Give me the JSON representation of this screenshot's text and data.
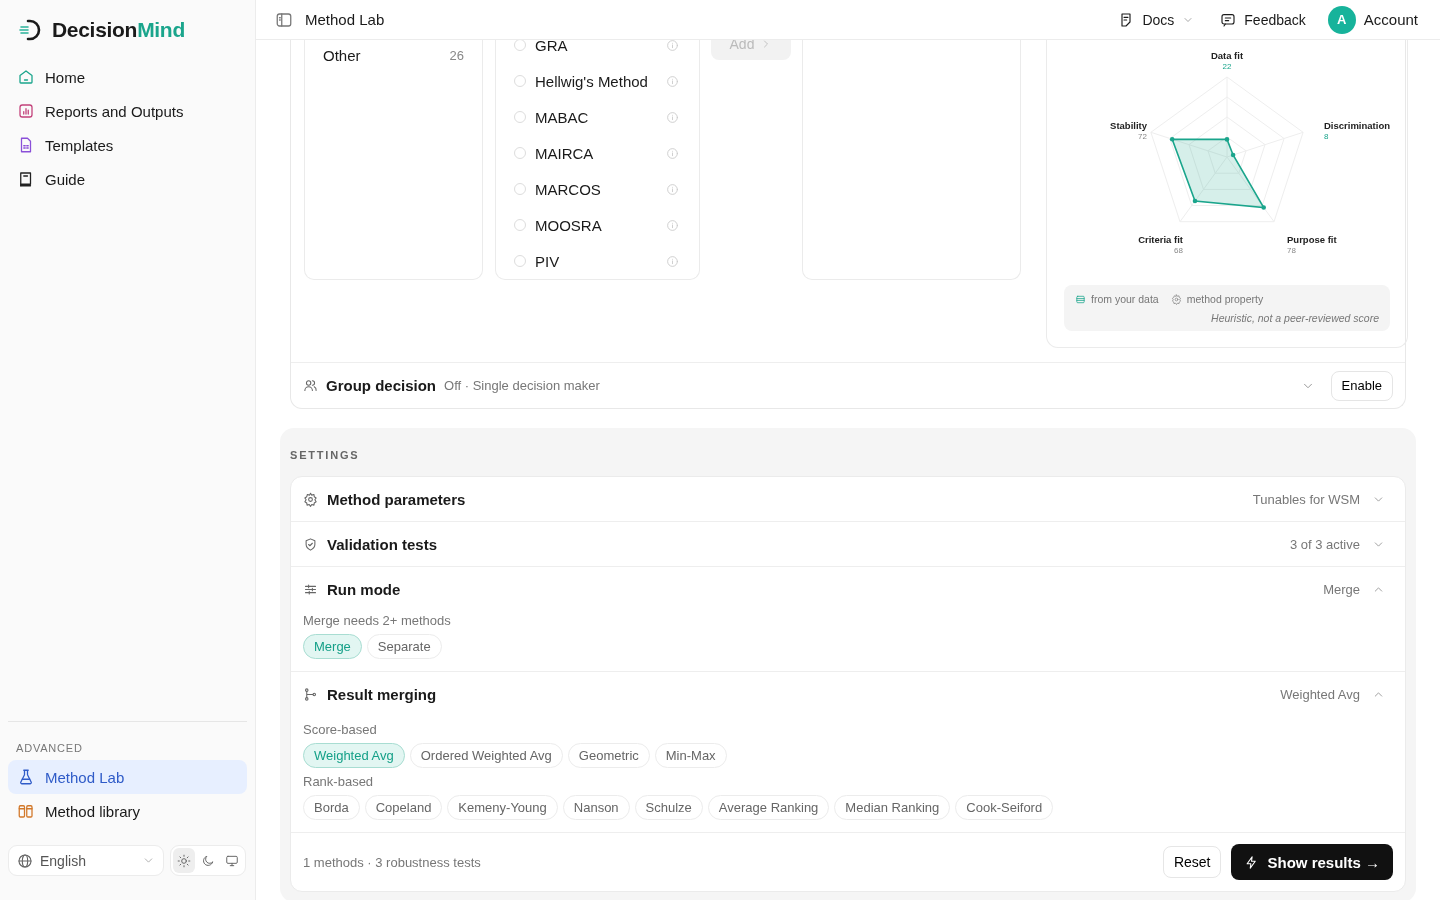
{
  "sidebar": {
    "brand": {
      "name": "Decision",
      "accent": "Mind"
    },
    "nav": [
      {
        "label": "Home",
        "kind": "home",
        "selected": false
      },
      {
        "label": "Reports and Outputs",
        "kind": "reports",
        "selected": false
      },
      {
        "label": "Templates",
        "kind": "templates",
        "selected": false
      },
      {
        "label": "Guide",
        "kind": "guide",
        "selected": false
      }
    ],
    "advanced": {
      "title": "ADVANCED",
      "items": [
        {
          "label": "Method Lab",
          "kind": "lab",
          "selected": true
        },
        {
          "label": "Method library",
          "kind": "library",
          "selected": false
        }
      ]
    },
    "language": "English",
    "themes": [
      {
        "kind": "light",
        "selected": true
      },
      {
        "kind": "dark",
        "selected": false
      },
      {
        "kind": "system",
        "selected": false
      }
    ]
  },
  "header": {
    "title": "Method Lab",
    "docs": "Docs",
    "feedback": "Feedback",
    "avatar": "A",
    "account": "Account"
  },
  "picker": {
    "categories": [
      {
        "label": "Other",
        "count": "26"
      }
    ],
    "methods": [
      {
        "name": "GRA",
        "selected": false
      },
      {
        "name": "Hellwig's Method",
        "selected": false
      },
      {
        "name": "MABAC",
        "selected": false
      },
      {
        "name": "MAIRCA",
        "selected": false
      },
      {
        "name": "MARCOS",
        "selected": false
      },
      {
        "name": "MOOSRA",
        "selected": false
      },
      {
        "name": "PIV",
        "selected": false
      }
    ],
    "add_button": {
      "label": "Add",
      "disabled": true
    },
    "radar": {
      "axes": [
        {
          "label": "Data fit",
          "value": "22",
          "kind": "data"
        },
        {
          "label": "Stability",
          "value": "72",
          "kind": "method"
        },
        {
          "label": "Discrimination",
          "value": "8",
          "kind": "data"
        },
        {
          "label": "Criteria fit",
          "value": "68",
          "kind": "method"
        },
        {
          "label": "Purpose fit",
          "value": "78",
          "kind": "method"
        }
      ],
      "legend": [
        {
          "kind": "data",
          "label": "from your data"
        },
        {
          "kind": "method",
          "label": "method property"
        }
      ],
      "note": "Heuristic, not a peer-reviewed score"
    },
    "group_decision": {
      "title": "Group decision",
      "status": "Off · Single decision maker",
      "expanded": false,
      "button": "Enable"
    }
  },
  "settings": {
    "heading": "SETTINGS",
    "sections": [
      {
        "kind": "parameters",
        "title": "Method parameters",
        "summary": "Tunables for WSM",
        "expanded": false
      },
      {
        "kind": "validation",
        "title": "Validation tests",
        "summary": "3 of 3 active",
        "expanded": false
      },
      {
        "kind": "run_mode",
        "title": "Run mode",
        "summary": "Merge",
        "expanded": true,
        "hint": "Merge needs 2+ methods",
        "groups": [
          {
            "options": [
              {
                "label": "Merge",
                "selected": true
              },
              {
                "label": "Separate",
                "selected": false
              }
            ]
          }
        ]
      },
      {
        "kind": "merging",
        "title": "Result merging",
        "summary": "Weighted Avg",
        "expanded": true,
        "groups": [
          {
            "label": "Score-based",
            "options": [
              {
                "label": "Weighted Avg",
                "selected": true
              },
              {
                "label": "Ordered Weighted Avg",
                "selected": false
              },
              {
                "label": "Geometric",
                "selected": false
              },
              {
                "label": "Min-Max",
                "selected": false
              }
            ]
          },
          {
            "label": "Rank-based",
            "options": [
              {
                "label": "Borda",
                "selected": false
              },
              {
                "label": "Copeland",
                "selected": false
              },
              {
                "label": "Kemeny-Young",
                "selected": false
              },
              {
                "label": "Nanson",
                "selected": false
              },
              {
                "label": "Schulze",
                "selected": false
              },
              {
                "label": "Average Ranking",
                "selected": false
              },
              {
                "label": "Median Ranking",
                "selected": false
              },
              {
                "label": "Cook-Seiford",
                "selected": false
              }
            ]
          }
        ]
      }
    ],
    "footer": {
      "summary": "1 methods · 3 robustness tests",
      "reset": "Reset",
      "primary": "Show results →"
    }
  }
}
